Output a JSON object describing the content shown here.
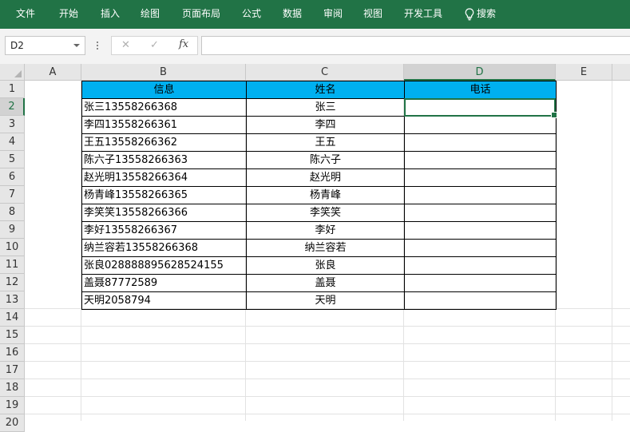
{
  "menu": [
    "文件",
    "开始",
    "插入",
    "绘图",
    "页面布局",
    "公式",
    "数据",
    "审阅",
    "视图",
    "开发工具"
  ],
  "search_label": "搜索",
  "namebox": "D2",
  "formula": {
    "cancel": "✕",
    "enter": "✓",
    "fx": "fx",
    "value": ""
  },
  "columns": [
    "A",
    "B",
    "C",
    "D",
    "E"
  ],
  "selected_column": "D",
  "rows": [
    "1",
    "2",
    "3",
    "4",
    "5",
    "6",
    "7",
    "8",
    "9",
    "10",
    "11",
    "12",
    "13",
    "14",
    "15",
    "16",
    "17",
    "18",
    "19",
    "20"
  ],
  "selected_row": "2",
  "table": {
    "headers": [
      "信息",
      "姓名",
      "电话"
    ],
    "rows": [
      [
        "张三13558266368",
        "张三",
        ""
      ],
      [
        "李四13558266361",
        "李四",
        ""
      ],
      [
        "王五13558266362",
        "王五",
        ""
      ],
      [
        "陈六子13558266363",
        "陈六子",
        ""
      ],
      [
        "赵光明13558266364",
        "赵光明",
        ""
      ],
      [
        "杨青峰13558266365",
        "杨青峰",
        ""
      ],
      [
        "李笑笑13558266366",
        "李笑笑",
        ""
      ],
      [
        "李好13558266367",
        "李好",
        ""
      ],
      [
        "纳兰容若13558266368",
        "纳兰容若",
        ""
      ],
      [
        "张良028888895628524155",
        "张良",
        ""
      ],
      [
        "盖聂87772589",
        "盖聂",
        ""
      ],
      [
        "天明2058794",
        "天明",
        ""
      ]
    ]
  },
  "colors": {
    "ribbon": "#217346",
    "header_fill": "#00b0f0"
  }
}
